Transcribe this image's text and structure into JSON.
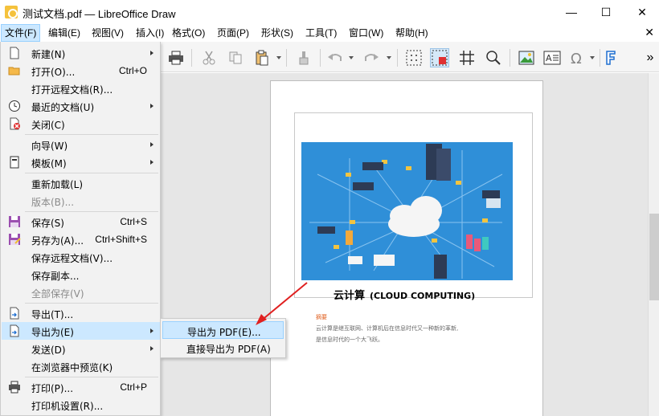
{
  "window": {
    "title": "测试文档.pdf — LibreOffice Draw",
    "minimize_icon": "minimize-icon",
    "maximize_icon": "maximize-icon",
    "close_icon": "close-icon",
    "minimize_glyph": "—",
    "maximize_glyph": "☐",
    "close_glyph": "✕"
  },
  "menubar": {
    "items": [
      {
        "label": "文件(F)"
      },
      {
        "label": "编辑(E)"
      },
      {
        "label": "视图(V)"
      },
      {
        "label": "插入(I)"
      },
      {
        "label": "格式(O)"
      },
      {
        "label": "页面(P)"
      },
      {
        "label": "形状(S)"
      },
      {
        "label": "工具(T)"
      },
      {
        "label": "窗口(W)"
      },
      {
        "label": "帮助(H)"
      }
    ],
    "close_document_glyph": "✕"
  },
  "toolbar": {
    "overflow_glyph": "»"
  },
  "file_menu": {
    "items": [
      {
        "label": "新建(N)",
        "shortcut": "",
        "submenu": true
      },
      {
        "label": "打开(O)...",
        "shortcut": "Ctrl+O",
        "submenu": false
      },
      {
        "label": "打开远程文档(R)...",
        "shortcut": "",
        "submenu": false
      },
      {
        "label": "最近的文档(U)",
        "shortcut": "",
        "submenu": true
      },
      {
        "label": "关闭(C)",
        "shortcut": "",
        "submenu": false
      },
      {
        "label": "向导(W)",
        "shortcut": "",
        "submenu": true
      },
      {
        "label": "模板(M)",
        "shortcut": "",
        "submenu": true
      },
      {
        "label": "重新加载(L)",
        "shortcut": "",
        "submenu": false
      },
      {
        "label": "版本(B)...",
        "shortcut": "",
        "submenu": false,
        "disabled": true
      },
      {
        "label": "保存(S)",
        "shortcut": "Ctrl+S",
        "submenu": false
      },
      {
        "label": "另存为(A)...",
        "shortcut": "Ctrl+Shift+S",
        "submenu": false
      },
      {
        "label": "保存远程文档(V)...",
        "shortcut": "",
        "submenu": false
      },
      {
        "label": "保存副本...",
        "shortcut": "",
        "submenu": false
      },
      {
        "label": "全部保存(V)",
        "shortcut": "",
        "submenu": false,
        "disabled": true
      },
      {
        "label": "导出(T)...",
        "shortcut": "",
        "submenu": false
      },
      {
        "label": "导出为(E)",
        "shortcut": "",
        "submenu": true,
        "highlighted": true
      },
      {
        "label": "发送(D)",
        "shortcut": "",
        "submenu": true
      },
      {
        "label": "在浏览器中预览(K)",
        "shortcut": "",
        "submenu": false
      },
      {
        "label": "打印(P)...",
        "shortcut": "Ctrl+P",
        "submenu": false
      },
      {
        "label": "打印机设置(R)...",
        "shortcut": "",
        "submenu": false
      }
    ]
  },
  "export_submenu": {
    "items": [
      {
        "label": "导出为 PDF(E)...",
        "highlighted": true
      },
      {
        "label": "直接导出为 PDF(A)"
      }
    ]
  },
  "document": {
    "heading": "云计算",
    "heading_en": "(CLOUD COMPUTING)",
    "abstract_label": "摘要",
    "abstract_line1": "云计算是继互联网、计算机后在信息时代又一种新的革新,",
    "abstract_line2": "是信息时代的一个大飞跃。"
  },
  "colors": {
    "menu_highlight": "#cce8ff",
    "image_background": "#2f8fd8",
    "annotation_arrow": "#e02020",
    "abstract_label": "#e06020"
  }
}
